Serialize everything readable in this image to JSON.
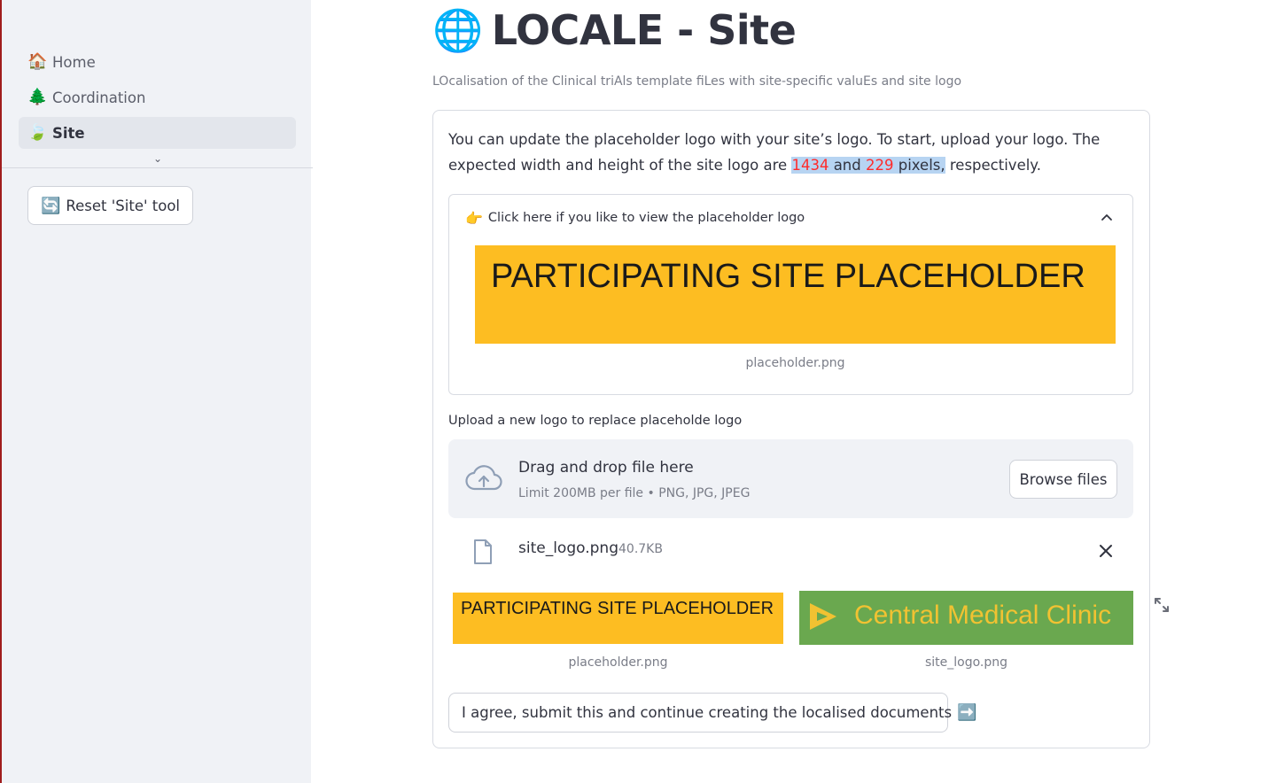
{
  "sidebar": {
    "items": [
      {
        "icon": "house-icon",
        "emoji": "🏠",
        "label": "Home",
        "active": false
      },
      {
        "icon": "tree-icon",
        "emoji": "🌲",
        "label": "Coordination",
        "active": false
      },
      {
        "icon": "leaf-icon",
        "emoji": "🍃",
        "label": "Site",
        "active": true
      }
    ],
    "more_icon": "chevron-down-icon",
    "more_glyph": "⌄",
    "reset_button": {
      "emoji": "🔄",
      "label": "Reset 'Site' tool"
    }
  },
  "main": {
    "title_emoji": "🌐",
    "title": "LOCALE - Site",
    "caption": "LOcalisation of the Clinical triAls template fiLes with site-specific valuEs and site logo",
    "intro": {
      "before": "You can update the placeholder logo with your site’s logo. To start, upload your logo. The expected width and height of the site logo are ",
      "width_value": "1434",
      "and": " and ",
      "height_value": "229",
      "unit": " pixels,",
      "after": " respectively."
    },
    "expander": {
      "emoji": "👉",
      "label": "Click here if you like to view the placeholder logo",
      "expanded": true,
      "image_text": "PARTICIPATING SITE PLACEHOLDER",
      "image_caption": "placeholder.png"
    },
    "uploader": {
      "label": "Upload a new logo to replace placeholde logo",
      "drop_title": "Drag and drop file here",
      "limit": "Limit 200MB per file • PNG, JPG, JPEG",
      "browse_label": "Browse files",
      "file": {
        "name": "site_logo.png",
        "size": "40.7KB"
      }
    },
    "comparison": {
      "left": {
        "image_text": "PARTICIPATING SITE PLACEHOLDER",
        "caption": "placeholder.png"
      },
      "right": {
        "image_text": "Central Medical Clinic",
        "caption": "site_logo.png"
      }
    },
    "submit": {
      "label": "I agree, submit this and continue creating the localised documents",
      "emoji": "➡️"
    }
  },
  "colors": {
    "sidebar_bg": "#f0f2f6",
    "accent_red": "#ff2b2b",
    "highlight": "#b7d4f2",
    "placeholder_yellow": "#fdbd22",
    "logo_green": "#6aa84f",
    "logo_gold": "#f1c232"
  }
}
